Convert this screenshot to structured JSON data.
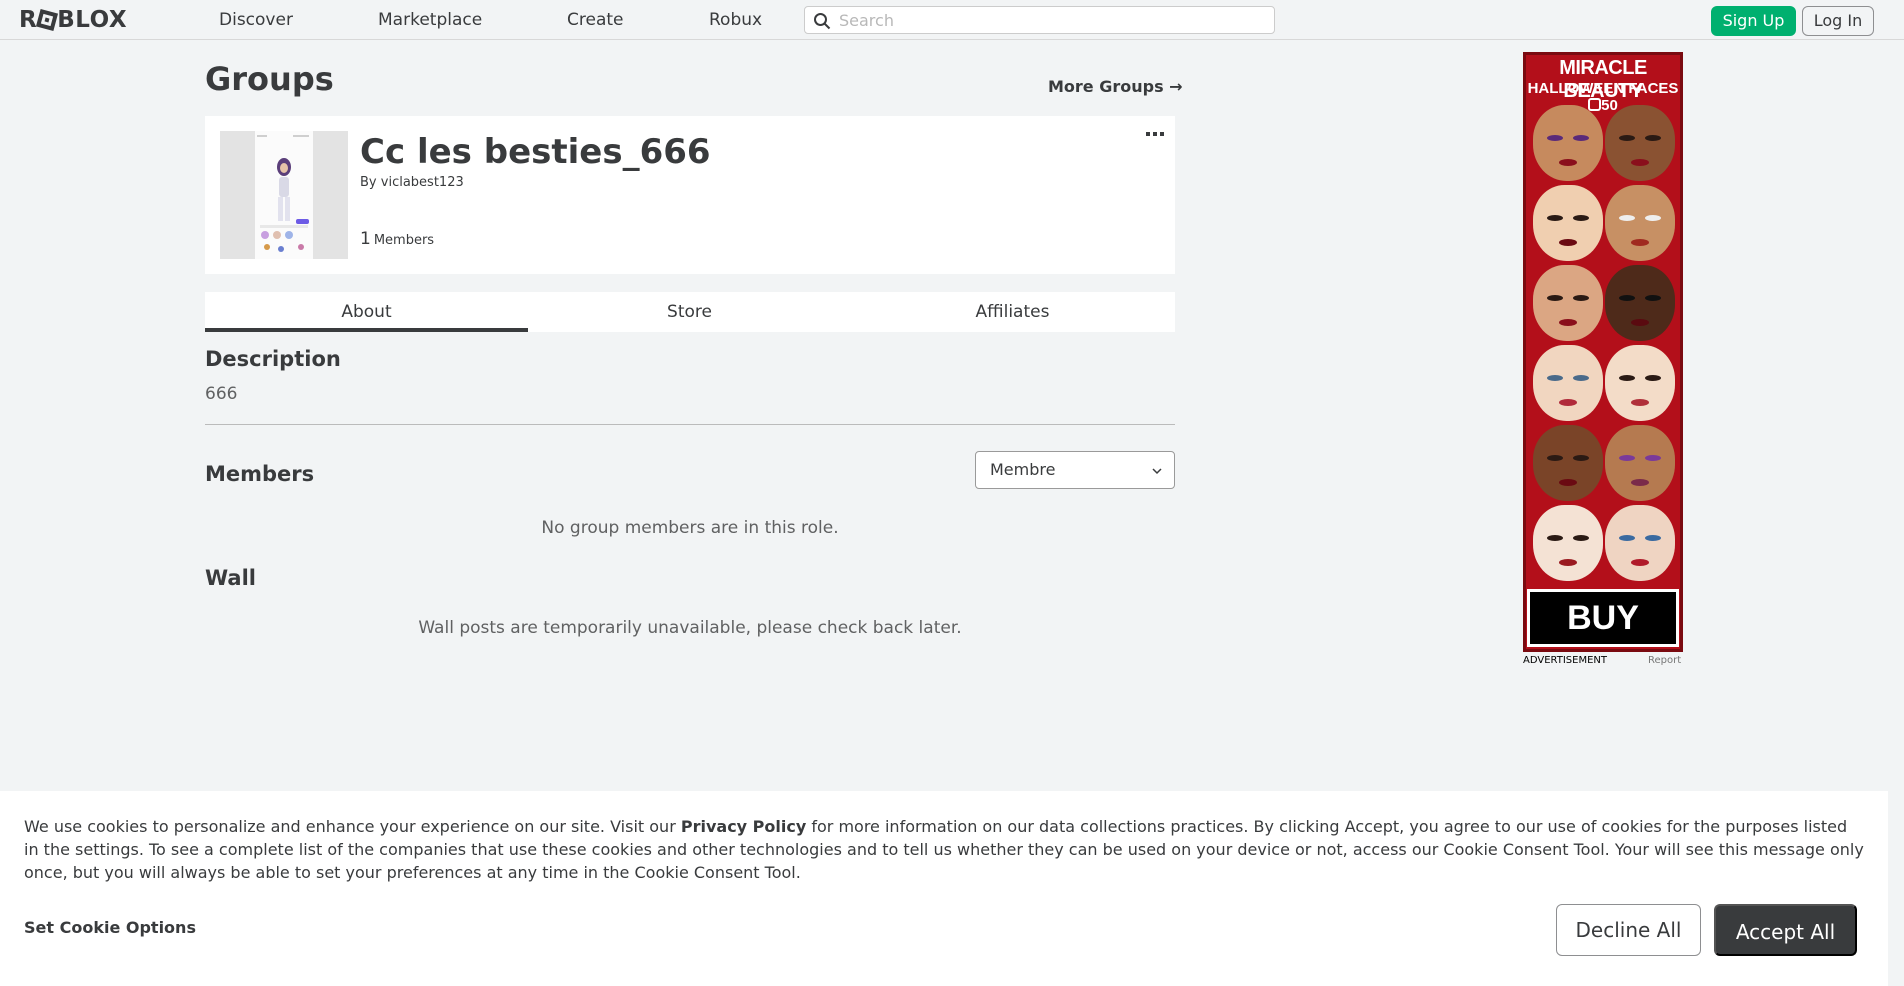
{
  "header": {
    "logo_text": "ROBLOX",
    "nav": [
      "Discover",
      "Marketplace",
      "Create",
      "Robux"
    ],
    "search_placeholder": "Search",
    "signup_label": "Sign Up",
    "login_label": "Log In"
  },
  "page": {
    "title": "Groups",
    "more_groups": "More Groups →"
  },
  "group": {
    "name": "Cc les besties_666",
    "owner_prefix": "By",
    "owner": "viclabest123",
    "member_count": "1",
    "member_label": "Members"
  },
  "tabs": [
    "About",
    "Store",
    "Affiliates"
  ],
  "about": {
    "description_title": "Description",
    "description_text": "666",
    "members_title": "Members",
    "role_selected": "Membre",
    "no_members_text": "No group members are in this role.",
    "wall_title": "Wall",
    "wall_unavailable_text": "Wall posts are temporarily unavailable, please check back later."
  },
  "ad": {
    "title": "MIRACLE BEAUTY",
    "subtitle": "HALLOWEEN FACES",
    "price": "50",
    "cta": "BUY NOW",
    "label": "ADVERTISEMENT",
    "report": "Report"
  },
  "cookie": {
    "text_before_link": "We use cookies to personalize and enhance your experience on our site. Visit our ",
    "link": "Privacy Policy",
    "text_after_link": " for more information on our data collections practices. By clicking Accept, you agree to our use of cookies for the purposes listed in the settings. To see a complete list of the companies that use these cookies and other technologies and to tell us whether they can be used on your device or not, access our Cookie Consent Tool. Your will see this message only once, but you will always be able to set your preferences at any time in the Cookie Consent Tool.",
    "options_label": "Set Cookie Options",
    "decline_label": "Decline All",
    "accept_label": "Accept All"
  },
  "colors": {
    "signup": "#00b06f",
    "accept": "#393b3d",
    "page_bg": "#f2f4f5"
  }
}
